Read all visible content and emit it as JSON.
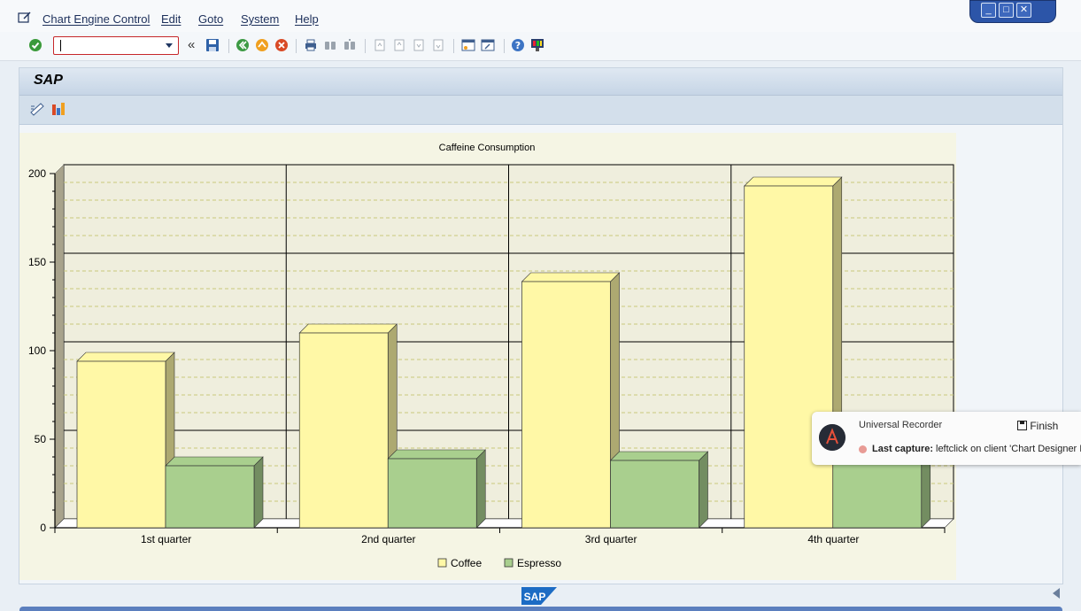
{
  "menu": {
    "items": [
      "Chart Engine Control",
      "Edit",
      "Goto",
      "System",
      "Help"
    ]
  },
  "window_controls": [
    "minimize",
    "maximize",
    "close"
  ],
  "toolbar": {
    "command_field_value": "",
    "icons": [
      "enter-icon",
      "save-icon",
      "back-icon",
      "exit-icon",
      "cancel-icon",
      "print-icon",
      "find-icon",
      "find-next-icon",
      "first-page-icon",
      "previous-page-icon",
      "next-page-icon",
      "last-page-icon",
      "create-session-icon",
      "shortcut-icon",
      "help-icon",
      "customize-layout-icon"
    ]
  },
  "app": {
    "title": "SAP",
    "toolbar_icons": [
      "chart-designer-icon",
      "chart-type-icon"
    ]
  },
  "chart_data": {
    "type": "bar",
    "style": "3d-clustered",
    "title": "Caffeine Consumption",
    "categories": [
      "1st quarter",
      "2nd quarter",
      "3rd quarter",
      "4th quarter"
    ],
    "series": [
      {
        "name": "Coffee",
        "values": [
          94,
          110,
          139,
          193
        ],
        "color": "#fff8a6"
      },
      {
        "name": "Espresso",
        "values": [
          35,
          39,
          38,
          42
        ],
        "color": "#a9cf8e"
      }
    ],
    "ylim": [
      0,
      200
    ],
    "yticks": [
      "0",
      "50",
      "100",
      "150",
      "200"
    ],
    "grid": true,
    "legend_position": "bottom",
    "background_color": "#f5f5e4",
    "plot_color": "#efeedd"
  },
  "recorder": {
    "title": "Universal Recorder",
    "finish_label": "Finish",
    "capture_label": "Last capture:",
    "capture_text": "leftclick on client 'Chart Designer I"
  },
  "footer": {
    "logo_text": "SAP"
  }
}
